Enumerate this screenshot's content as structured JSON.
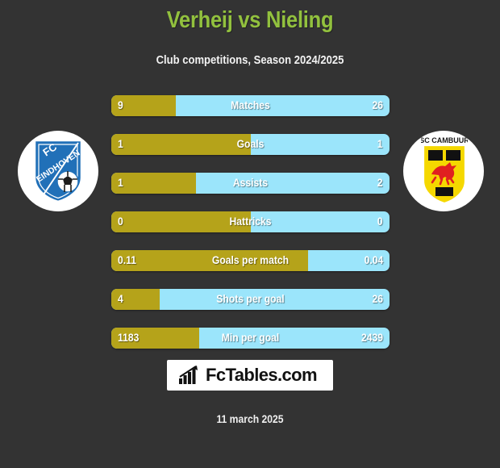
{
  "header": {
    "title": "Verheij vs Nieling",
    "subtitle": "Club competitions, Season 2024/2025"
  },
  "teams": {
    "left": {
      "name": "FC Eindhoven",
      "logo_name": "fc-eindhoven-logo",
      "shield_text_top": "FC",
      "shield_text_bottom": "EINDHOVEN",
      "colors": {
        "shield": "#2170b8",
        "circle": "#ffffff"
      }
    },
    "right": {
      "name": "SC Cambuur",
      "logo_name": "sc-cambuur-logo",
      "shield_text_top": "SC CAMBUUR",
      "colors": {
        "shield": "#f5d800",
        "blocks": "#111111",
        "horse": "#e02020",
        "circle": "#ffffff"
      }
    }
  },
  "colors": {
    "background": "#333333",
    "title": "#92c13e",
    "bar_left": "#b5a31a",
    "bar_right": "#9be5fb",
    "text": "#ffffff"
  },
  "chart_data": {
    "type": "bar",
    "title": "Verheij vs Nieling",
    "subtitle": "Club competitions, Season 2024/2025",
    "orientation": "horizontal-diverging",
    "series": [
      {
        "name": "Verheij",
        "side": "left",
        "color": "#b5a31a"
      },
      {
        "name": "Nieling",
        "side": "right",
        "color": "#9be5fb"
      }
    ],
    "categories": [
      "Matches",
      "Goals",
      "Assists",
      "Hattricks",
      "Goals per match",
      "Shots per goal",
      "Min per goal"
    ],
    "rows": [
      {
        "label": "Matches",
        "left": "9",
        "right": "26",
        "left_pct": 23.2
      },
      {
        "label": "Goals",
        "left": "1",
        "right": "1",
        "left_pct": 50.0
      },
      {
        "label": "Assists",
        "left": "1",
        "right": "2",
        "left_pct": 30.4
      },
      {
        "label": "Hattricks",
        "left": "0",
        "right": "0",
        "left_pct": 50.0
      },
      {
        "label": "Goals per match",
        "left": "0.11",
        "right": "0.04",
        "left_pct": 70.7
      },
      {
        "label": "Shots per goal",
        "left": "4",
        "right": "26",
        "left_pct": 17.4
      },
      {
        "label": "Min per goal",
        "left": "1183",
        "right": "2439",
        "left_pct": 31.6
      }
    ]
  },
  "footer": {
    "brand": "FcTables.com",
    "brand_icon": "bar-chart-icon",
    "date": "11 march 2025"
  }
}
